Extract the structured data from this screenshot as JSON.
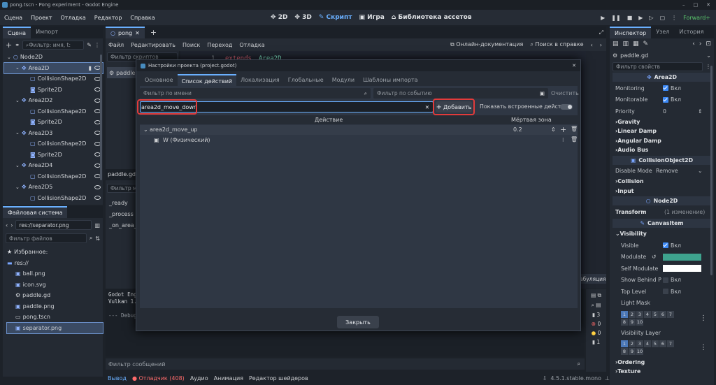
{
  "titlebar": {
    "title": "pong.tscn - Pong experiment - Godot Engine"
  },
  "menu": [
    "Сцена",
    "Проект",
    "Отладка",
    "Редактор",
    "Справка"
  ],
  "editors": {
    "d2": "2D",
    "d3": "3D",
    "script": "Скрипт",
    "game": "Игра",
    "assetlib": "Библиотека ассетов"
  },
  "renderer": "Forward+",
  "scene_panel": {
    "tabs": [
      "Сцена",
      "Импорт"
    ],
    "filter_placeholder": "Фильтр: имя, t:",
    "nodes": [
      {
        "label": "Node2D",
        "depth": 0,
        "icon": "node2d",
        "eye": false
      },
      {
        "label": "Area2D",
        "depth": 1,
        "icon": "area2d",
        "eye": true,
        "selected": true
      },
      {
        "label": "CollisionShape2D",
        "depth": 2,
        "icon": "collision",
        "eye": true
      },
      {
        "label": "Sprite2D",
        "depth": 2,
        "icon": "sprite",
        "eye": true
      },
      {
        "label": "Area2D2",
        "depth": 1,
        "icon": "area2d",
        "eye": true
      },
      {
        "label": "CollisionShape2D",
        "depth": 2,
        "icon": "collision",
        "eye": true
      },
      {
        "label": "Sprite2D",
        "depth": 2,
        "icon": "sprite",
        "eye": true
      },
      {
        "label": "Area2D3",
        "depth": 1,
        "icon": "area2d",
        "eye": true
      },
      {
        "label": "CollisionShape2D",
        "depth": 2,
        "icon": "collision",
        "eye": true
      },
      {
        "label": "Sprite2D",
        "depth": 2,
        "icon": "sprite",
        "eye": true
      },
      {
        "label": "Area2D4",
        "depth": 1,
        "icon": "area2d",
        "eye": true
      },
      {
        "label": "CollisionShape2D",
        "depth": 2,
        "icon": "collision",
        "eye": true
      },
      {
        "label": "Area2D5",
        "depth": 1,
        "icon": "area2d",
        "eye": true
      },
      {
        "label": "CollisionShape2D",
        "depth": 2,
        "icon": "collision",
        "eye": true
      }
    ]
  },
  "fs_panel": {
    "title": "Файловая система",
    "path": "res://separator.png",
    "filter_placeholder": "Фильтр файлов",
    "items": [
      {
        "label": "Избранное:",
        "icon": "star",
        "depth": 0
      },
      {
        "label": "res://",
        "icon": "folder",
        "depth": 0
      },
      {
        "label": "ball.png",
        "icon": "image",
        "depth": 1
      },
      {
        "label": "icon.svg",
        "icon": "image",
        "depth": 1
      },
      {
        "label": "paddle.gd",
        "icon": "gear",
        "depth": 1
      },
      {
        "label": "paddle.png",
        "icon": "image",
        "depth": 1
      },
      {
        "label": "pong.tscn",
        "icon": "scene",
        "depth": 1
      },
      {
        "label": "separator.png",
        "icon": "image",
        "depth": 1,
        "selected": true
      }
    ]
  },
  "script_panel": {
    "tab": "pong",
    "menu": [
      "Файл",
      "Редактировать",
      "Поиск",
      "Переход",
      "Отладка"
    ],
    "online_docs": "Онлайн-документация",
    "search_help": "Поиск в справке",
    "filter_scripts": "Фильтр скриптов",
    "script_item": "paddle",
    "line_number": "1",
    "code_keyword": "extends",
    "code_class": "Area2D",
    "paddle_label": "paddle.gd",
    "filter_methods": "Фильтр м",
    "methods": [
      "_ready",
      "_process",
      "_on_area_"
    ],
    "tab_right": "абуляция"
  },
  "output": {
    "lines": [
      "Godot Eng",
      "Vulkan 1.",
      "",
      "--- Debug"
    ],
    "filter_placeholder": "Фильтр сообщений",
    "counts": [
      "3",
      "0",
      "0",
      "1"
    ]
  },
  "bottombar": {
    "items": [
      "Вывод",
      "Отладчик (408)",
      "Аудио",
      "Анимация",
      "Редактор шейдеров"
    ],
    "version": "4.5.1.stable.mono"
  },
  "inspector": {
    "tabs": [
      "Инспектор",
      "Узел",
      "История"
    ],
    "file": "paddle.gd",
    "filter_placeholder": "Фильтр свойств",
    "section_area": "Area2D",
    "monitoring_label": "Monitoring",
    "monitorable_label": "Monitorable",
    "on": "Вкл",
    "priority_label": "Priority",
    "priority_value": "0",
    "groups1": [
      "Gravity",
      "Linear Damp",
      "Angular Damp",
      "Audio Bus"
    ],
    "section_collision": "CollisionObject2D",
    "disable_mode_label": "Disable Mode",
    "disable_mode_value": "Remove",
    "groups2": [
      "Collision",
      "Input"
    ],
    "section_node2d": "Node2D",
    "transform_label": "Transform",
    "transform_note": "(1 изменение)",
    "section_canvas": "CanvasItem",
    "visibility_label": "Visibility",
    "visible_label": "Visible",
    "modulate_label": "Modulate",
    "modulate_color": "#3ea38e",
    "self_modulate_label": "Self Modulate",
    "self_modulate_color": "#ffffff",
    "show_behind_label": "Show Behind P",
    "top_level_label": "Top Level",
    "light_mask_label": "Light Mask",
    "visibility_layer_label": "Visibility Layer",
    "grid_numbers": [
      "1",
      "2",
      "3",
      "4",
      "5",
      "6",
      "7",
      "8",
      "9",
      "10"
    ],
    "ordering_label": "Ordering",
    "texture_label": "Texture"
  },
  "dialog": {
    "title": "Настройки проекта (project.godot)",
    "tabs": [
      "Основное",
      "Список действий",
      "Локализация",
      "Глобальные",
      "Модули",
      "Шаблоны импорта"
    ],
    "filter_name_placeholder": "Фильтр по имени",
    "filter_event_placeholder": "Фильтр по событию",
    "clear_label": "Очистить",
    "new_action_value": "area2d_move_down",
    "add_label": "Добавить",
    "show_builtin_label": "Показать встроенные действия",
    "col_action": "Действие",
    "col_deadzone": "Мёртвая зона",
    "actions": [
      {
        "name": "area2d_move_up",
        "deadzone": "0.2",
        "events": [
          "W (Физический)"
        ]
      }
    ],
    "close_label": "Закрыть"
  },
  "colors": {
    "accent": "#6ab0ff",
    "highlight_red": "#e23b3b",
    "debugger_red": "#ff6b6b"
  }
}
